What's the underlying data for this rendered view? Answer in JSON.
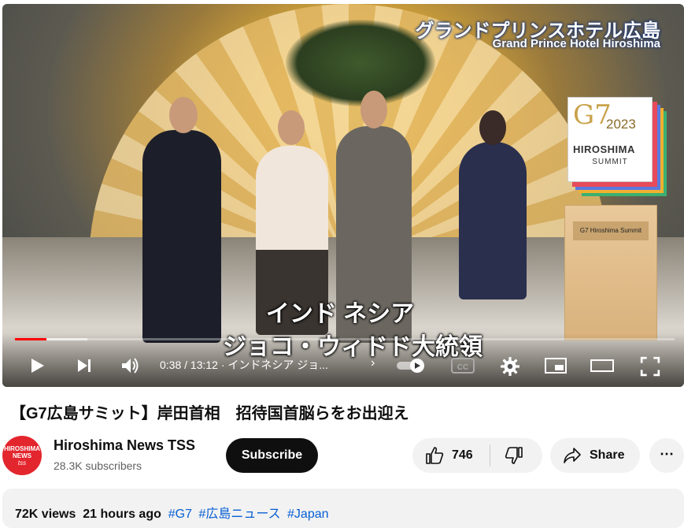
{
  "video": {
    "hotel_name_jp": "グランドプリンスホテル広島",
    "hotel_name_en": "Grand Prince Hotel Hiroshima",
    "subtitle_line1": "インド ネシア",
    "subtitle_line2": "ジョコ・ウィドド大統領",
    "logo": {
      "g7": "G7",
      "year": "2023",
      "city": "HIROSHIMA",
      "summit": "SUMMIT"
    },
    "pedestal_label": "G7 Hiroshima Summit"
  },
  "player": {
    "time_display": "0:38 / 13:12 · インドネシア ジョ...",
    "progress_played": 0.048,
    "progress_loaded": 0.11,
    "accent_color": "#ff0000",
    "icons": {
      "play": "play-icon",
      "next": "next-icon",
      "volume": "volume-icon",
      "autoplay": "autoplay-toggle",
      "captions": "captions-icon",
      "settings": "gear-icon",
      "miniplayer": "miniplayer-icon",
      "theater": "theater-icon",
      "fullscreen": "fullscreen-icon"
    },
    "captions_label": "CC"
  },
  "title": "【G7広島サミット】岸田首相　招待国首脳らをお出迎え",
  "channel": {
    "name": "Hiroshima News TSS",
    "subscribers": "28.3K subscribers",
    "avatar_line1": "HIROSHIMA",
    "avatar_line2": "NEWS",
    "avatar_line3": "tss",
    "avatar_color": "#e3262e"
  },
  "actions": {
    "subscribe_label": "Subscribe",
    "like_count": "746",
    "share_label": "Share",
    "more_label": "⋯"
  },
  "description": {
    "views": "72K views",
    "age": "21 hours ago",
    "tags": [
      "#G7",
      "#広島ニュース",
      "#Japan"
    ]
  }
}
